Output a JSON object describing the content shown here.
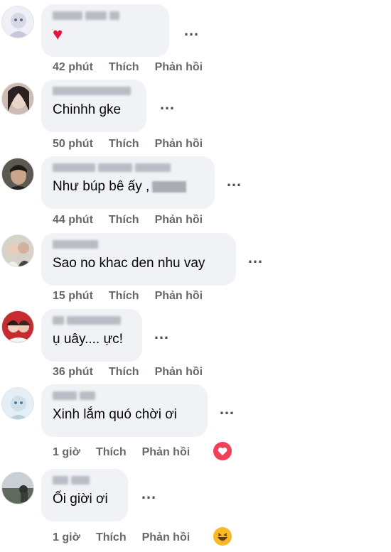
{
  "comments": [
    {
      "text": "♥",
      "time": "42 phút",
      "like": "Thích",
      "reply": "Phản hồi"
    },
    {
      "text": "Chinhh gke",
      "time": "50 phút",
      "like": "Thích",
      "reply": "Phản hồi"
    },
    {
      "text": "Như búp bê ấy ,",
      "time": "44 phút",
      "like": "Thích",
      "reply": "Phản hồi"
    },
    {
      "text": "Sao no khac den nhu vay",
      "time": "15 phút",
      "like": "Thích",
      "reply": "Phản hồi"
    },
    {
      "text": "ụ uây.... ực!",
      "time": "36 phút",
      "like": "Thích",
      "reply": "Phản hồi"
    },
    {
      "text": "Xinh lắm quó chời ơi",
      "time": "1 giờ",
      "like": "Thích",
      "reply": "Phản hồi",
      "reaction": "love"
    },
    {
      "text": "Ối giời ơi",
      "time": "1 giờ",
      "like": "Thích",
      "reply": "Phản hồi",
      "reaction": "haha"
    }
  ],
  "more_label": "…",
  "colors": {
    "love": "#f33e58",
    "haha": "#f7b928",
    "meta": "#65676b",
    "bubble": "#f0f2f5"
  }
}
